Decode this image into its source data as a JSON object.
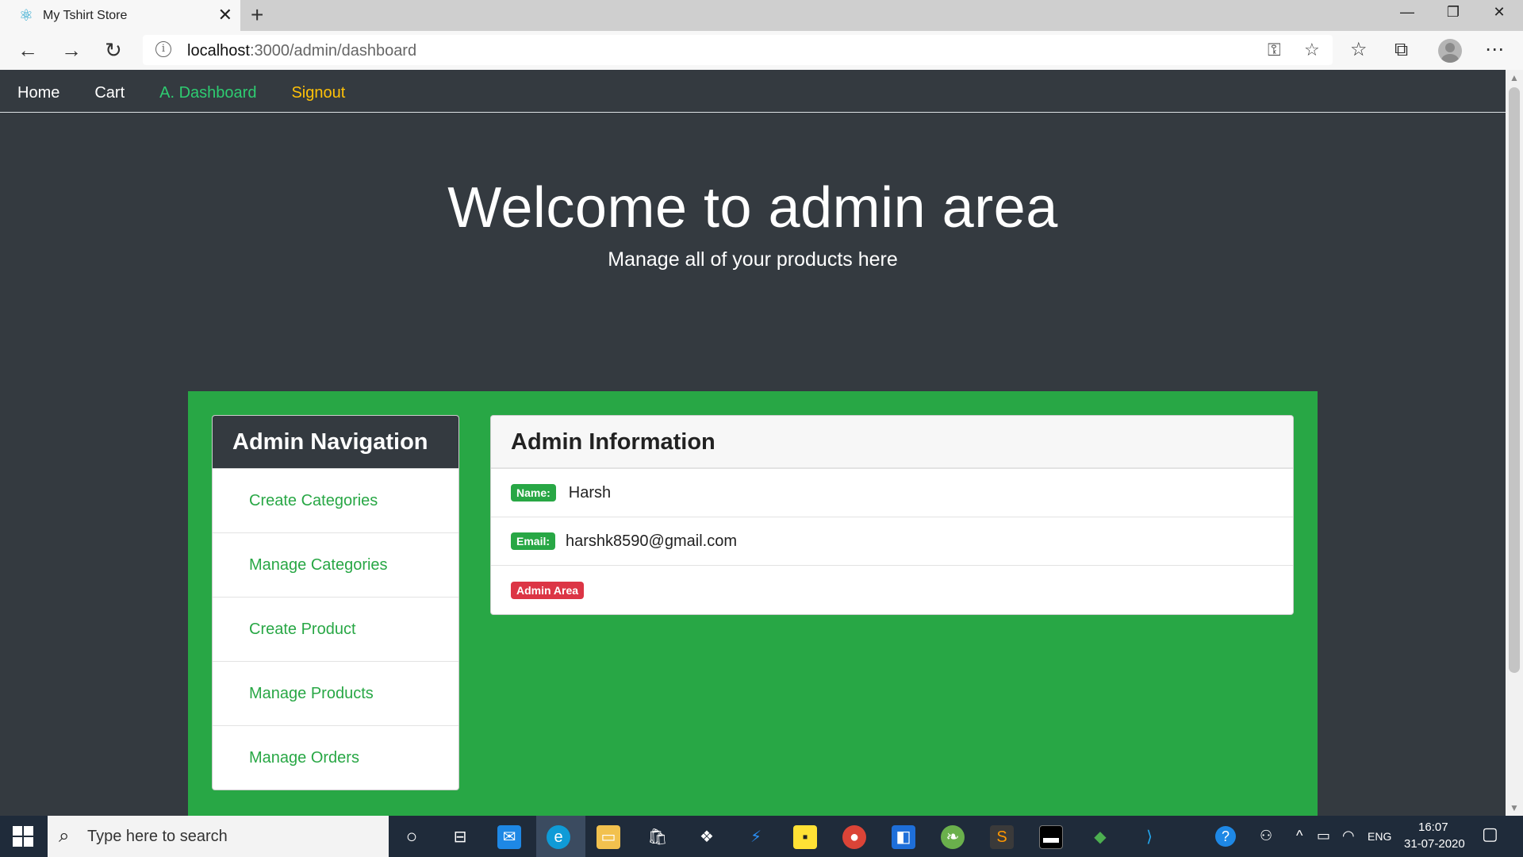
{
  "browser": {
    "tab_title": "My Tshirt Store",
    "url_host": "localhost",
    "url_path": ":3000/admin/dashboard",
    "icons": [
      "react-favicon",
      "close-icon",
      "new-tab-icon",
      "back-icon",
      "forward-icon",
      "refresh-icon",
      "info-icon",
      "key-icon",
      "star-icon",
      "favorites-icon",
      "collections-icon",
      "profile-icon",
      "more-icon"
    ]
  },
  "nav": {
    "home": "Home",
    "cart": "Cart",
    "dashboard": "A. Dashboard",
    "signout": "Signout"
  },
  "hero": {
    "title": "Welcome to admin area",
    "subtitle": "Manage all of your products here"
  },
  "admin_nav": {
    "header": "Admin Navigation",
    "items": [
      {
        "label": "Create Categories"
      },
      {
        "label": "Manage Categories"
      },
      {
        "label": "Create Product"
      },
      {
        "label": "Manage Products"
      },
      {
        "label": "Manage Orders"
      }
    ]
  },
  "admin_info": {
    "header": "Admin Information",
    "name_label": "Name:",
    "name_value": "Harsh",
    "email_label": "Email:",
    "email_value": "harshk8590@gmail.com",
    "area_badge": "Admin Area"
  },
  "taskbar": {
    "search_placeholder": "Type here to search",
    "language": "ENG",
    "time": "16:07",
    "date": "31-07-2020"
  },
  "colors": {
    "page_bg": "#343a40",
    "success": "#28a745",
    "danger": "#dc3545",
    "warning": "#ffc107",
    "active_nav": "#2ecc71"
  }
}
